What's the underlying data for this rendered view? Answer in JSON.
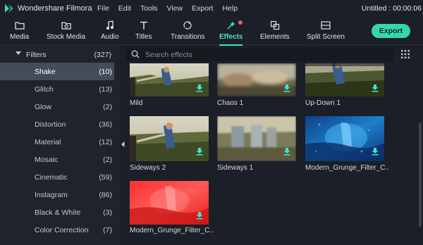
{
  "app": {
    "name": "Wondershare Filmora",
    "project": "Untitled : 00:00:06"
  },
  "menu": [
    "File",
    "Edit",
    "Tools",
    "View",
    "Export",
    "Help"
  ],
  "toolbar": {
    "tabs": [
      {
        "label": "Media",
        "icon": "folder-icon"
      },
      {
        "label": "Stock Media",
        "icon": "stock-media-icon"
      },
      {
        "label": "Audio",
        "icon": "music-note-icon"
      },
      {
        "label": "Titles",
        "icon": "text-t-icon"
      },
      {
        "label": "Transitions",
        "icon": "transitions-icon"
      },
      {
        "label": "Effects",
        "icon": "effects-icon",
        "active": true,
        "has_notification": true
      },
      {
        "label": "Elements",
        "icon": "elements-icon"
      },
      {
        "label": "Split Screen",
        "icon": "split-screen-icon"
      }
    ],
    "export_label": "Export",
    "accent_color": "#45e3c6",
    "notification_color": "#f25c5c"
  },
  "sidebar": {
    "header": {
      "label": "Filters",
      "count": "(327)"
    },
    "items": [
      {
        "label": "Shake",
        "count": "(10)",
        "selected": true
      },
      {
        "label": "Glitch",
        "count": "(13)"
      },
      {
        "label": "Glow",
        "count": "(2)"
      },
      {
        "label": "Distortion",
        "count": "(36)"
      },
      {
        "label": "Material",
        "count": "(12)"
      },
      {
        "label": "Mosaic",
        "count": "(2)"
      },
      {
        "label": "Cinematic",
        "count": "(59)"
      },
      {
        "label": "Instagram",
        "count": "(86)"
      },
      {
        "label": "Black & White",
        "count": "(3)"
      },
      {
        "label": "Color Correction",
        "count": "(7)"
      }
    ]
  },
  "search": {
    "placeholder": "Search effects"
  },
  "effects": [
    {
      "name": "Mild",
      "thumb": "vineyard-girl",
      "download_icon": "download-icon"
    },
    {
      "name": "Chaos 1",
      "thumb": "blurred-vineyard",
      "download_icon": "download-icon"
    },
    {
      "name": "Up-Down 1",
      "thumb": "vineyard-girl-dark",
      "download_icon": "download-icon"
    },
    {
      "name": "Sideways 2",
      "thumb": "vineyard-girl",
      "download_icon": "download-icon"
    },
    {
      "name": "Sideways 1",
      "thumb": "blurred-vineyard-wide",
      "download_icon": "download-icon"
    },
    {
      "name": "Modern_Grunge_Filter_C...",
      "thumb": "blue-grunge",
      "download_icon": "download-icon"
    },
    {
      "name": "Modern_Grunge_Filter_C...",
      "thumb": "red-grunge",
      "download_icon": "download-icon"
    }
  ]
}
